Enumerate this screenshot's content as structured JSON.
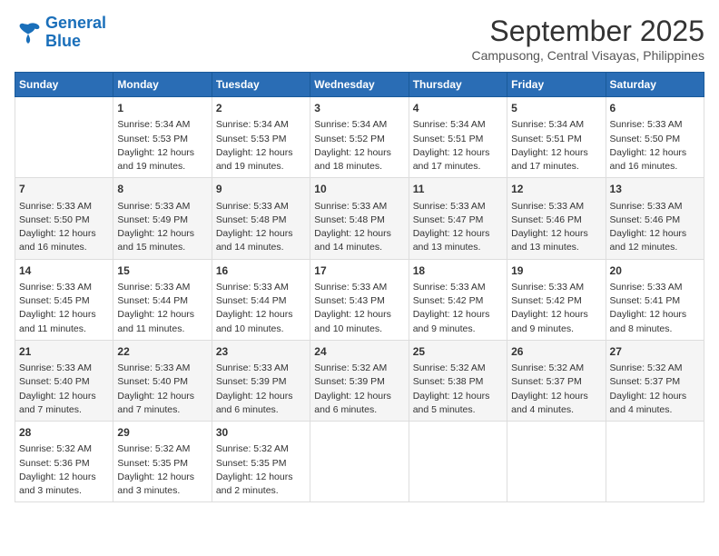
{
  "logo": {
    "line1": "General",
    "line2": "Blue"
  },
  "title": "September 2025",
  "subtitle": "Campusong, Central Visayas, Philippines",
  "headers": [
    "Sunday",
    "Monday",
    "Tuesday",
    "Wednesday",
    "Thursday",
    "Friday",
    "Saturday"
  ],
  "weeks": [
    [
      {
        "day": "",
        "content": ""
      },
      {
        "day": "1",
        "content": "Sunrise: 5:34 AM\nSunset: 5:53 PM\nDaylight: 12 hours\nand 19 minutes."
      },
      {
        "day": "2",
        "content": "Sunrise: 5:34 AM\nSunset: 5:53 PM\nDaylight: 12 hours\nand 19 minutes."
      },
      {
        "day": "3",
        "content": "Sunrise: 5:34 AM\nSunset: 5:52 PM\nDaylight: 12 hours\nand 18 minutes."
      },
      {
        "day": "4",
        "content": "Sunrise: 5:34 AM\nSunset: 5:51 PM\nDaylight: 12 hours\nand 17 minutes."
      },
      {
        "day": "5",
        "content": "Sunrise: 5:34 AM\nSunset: 5:51 PM\nDaylight: 12 hours\nand 17 minutes."
      },
      {
        "day": "6",
        "content": "Sunrise: 5:33 AM\nSunset: 5:50 PM\nDaylight: 12 hours\nand 16 minutes."
      }
    ],
    [
      {
        "day": "7",
        "content": "Sunrise: 5:33 AM\nSunset: 5:50 PM\nDaylight: 12 hours\nand 16 minutes."
      },
      {
        "day": "8",
        "content": "Sunrise: 5:33 AM\nSunset: 5:49 PM\nDaylight: 12 hours\nand 15 minutes."
      },
      {
        "day": "9",
        "content": "Sunrise: 5:33 AM\nSunset: 5:48 PM\nDaylight: 12 hours\nand 14 minutes."
      },
      {
        "day": "10",
        "content": "Sunrise: 5:33 AM\nSunset: 5:48 PM\nDaylight: 12 hours\nand 14 minutes."
      },
      {
        "day": "11",
        "content": "Sunrise: 5:33 AM\nSunset: 5:47 PM\nDaylight: 12 hours\nand 13 minutes."
      },
      {
        "day": "12",
        "content": "Sunrise: 5:33 AM\nSunset: 5:46 PM\nDaylight: 12 hours\nand 13 minutes."
      },
      {
        "day": "13",
        "content": "Sunrise: 5:33 AM\nSunset: 5:46 PM\nDaylight: 12 hours\nand 12 minutes."
      }
    ],
    [
      {
        "day": "14",
        "content": "Sunrise: 5:33 AM\nSunset: 5:45 PM\nDaylight: 12 hours\nand 11 minutes."
      },
      {
        "day": "15",
        "content": "Sunrise: 5:33 AM\nSunset: 5:44 PM\nDaylight: 12 hours\nand 11 minutes."
      },
      {
        "day": "16",
        "content": "Sunrise: 5:33 AM\nSunset: 5:44 PM\nDaylight: 12 hours\nand 10 minutes."
      },
      {
        "day": "17",
        "content": "Sunrise: 5:33 AM\nSunset: 5:43 PM\nDaylight: 12 hours\nand 10 minutes."
      },
      {
        "day": "18",
        "content": "Sunrise: 5:33 AM\nSunset: 5:42 PM\nDaylight: 12 hours\nand 9 minutes."
      },
      {
        "day": "19",
        "content": "Sunrise: 5:33 AM\nSunset: 5:42 PM\nDaylight: 12 hours\nand 9 minutes."
      },
      {
        "day": "20",
        "content": "Sunrise: 5:33 AM\nSunset: 5:41 PM\nDaylight: 12 hours\nand 8 minutes."
      }
    ],
    [
      {
        "day": "21",
        "content": "Sunrise: 5:33 AM\nSunset: 5:40 PM\nDaylight: 12 hours\nand 7 minutes."
      },
      {
        "day": "22",
        "content": "Sunrise: 5:33 AM\nSunset: 5:40 PM\nDaylight: 12 hours\nand 7 minutes."
      },
      {
        "day": "23",
        "content": "Sunrise: 5:33 AM\nSunset: 5:39 PM\nDaylight: 12 hours\nand 6 minutes."
      },
      {
        "day": "24",
        "content": "Sunrise: 5:32 AM\nSunset: 5:39 PM\nDaylight: 12 hours\nand 6 minutes."
      },
      {
        "day": "25",
        "content": "Sunrise: 5:32 AM\nSunset: 5:38 PM\nDaylight: 12 hours\nand 5 minutes."
      },
      {
        "day": "26",
        "content": "Sunrise: 5:32 AM\nSunset: 5:37 PM\nDaylight: 12 hours\nand 4 minutes."
      },
      {
        "day": "27",
        "content": "Sunrise: 5:32 AM\nSunset: 5:37 PM\nDaylight: 12 hours\nand 4 minutes."
      }
    ],
    [
      {
        "day": "28",
        "content": "Sunrise: 5:32 AM\nSunset: 5:36 PM\nDaylight: 12 hours\nand 3 minutes."
      },
      {
        "day": "29",
        "content": "Sunrise: 5:32 AM\nSunset: 5:35 PM\nDaylight: 12 hours\nand 3 minutes."
      },
      {
        "day": "30",
        "content": "Sunrise: 5:32 AM\nSunset: 5:35 PM\nDaylight: 12 hours\nand 2 minutes."
      },
      {
        "day": "",
        "content": ""
      },
      {
        "day": "",
        "content": ""
      },
      {
        "day": "",
        "content": ""
      },
      {
        "day": "",
        "content": ""
      }
    ]
  ]
}
